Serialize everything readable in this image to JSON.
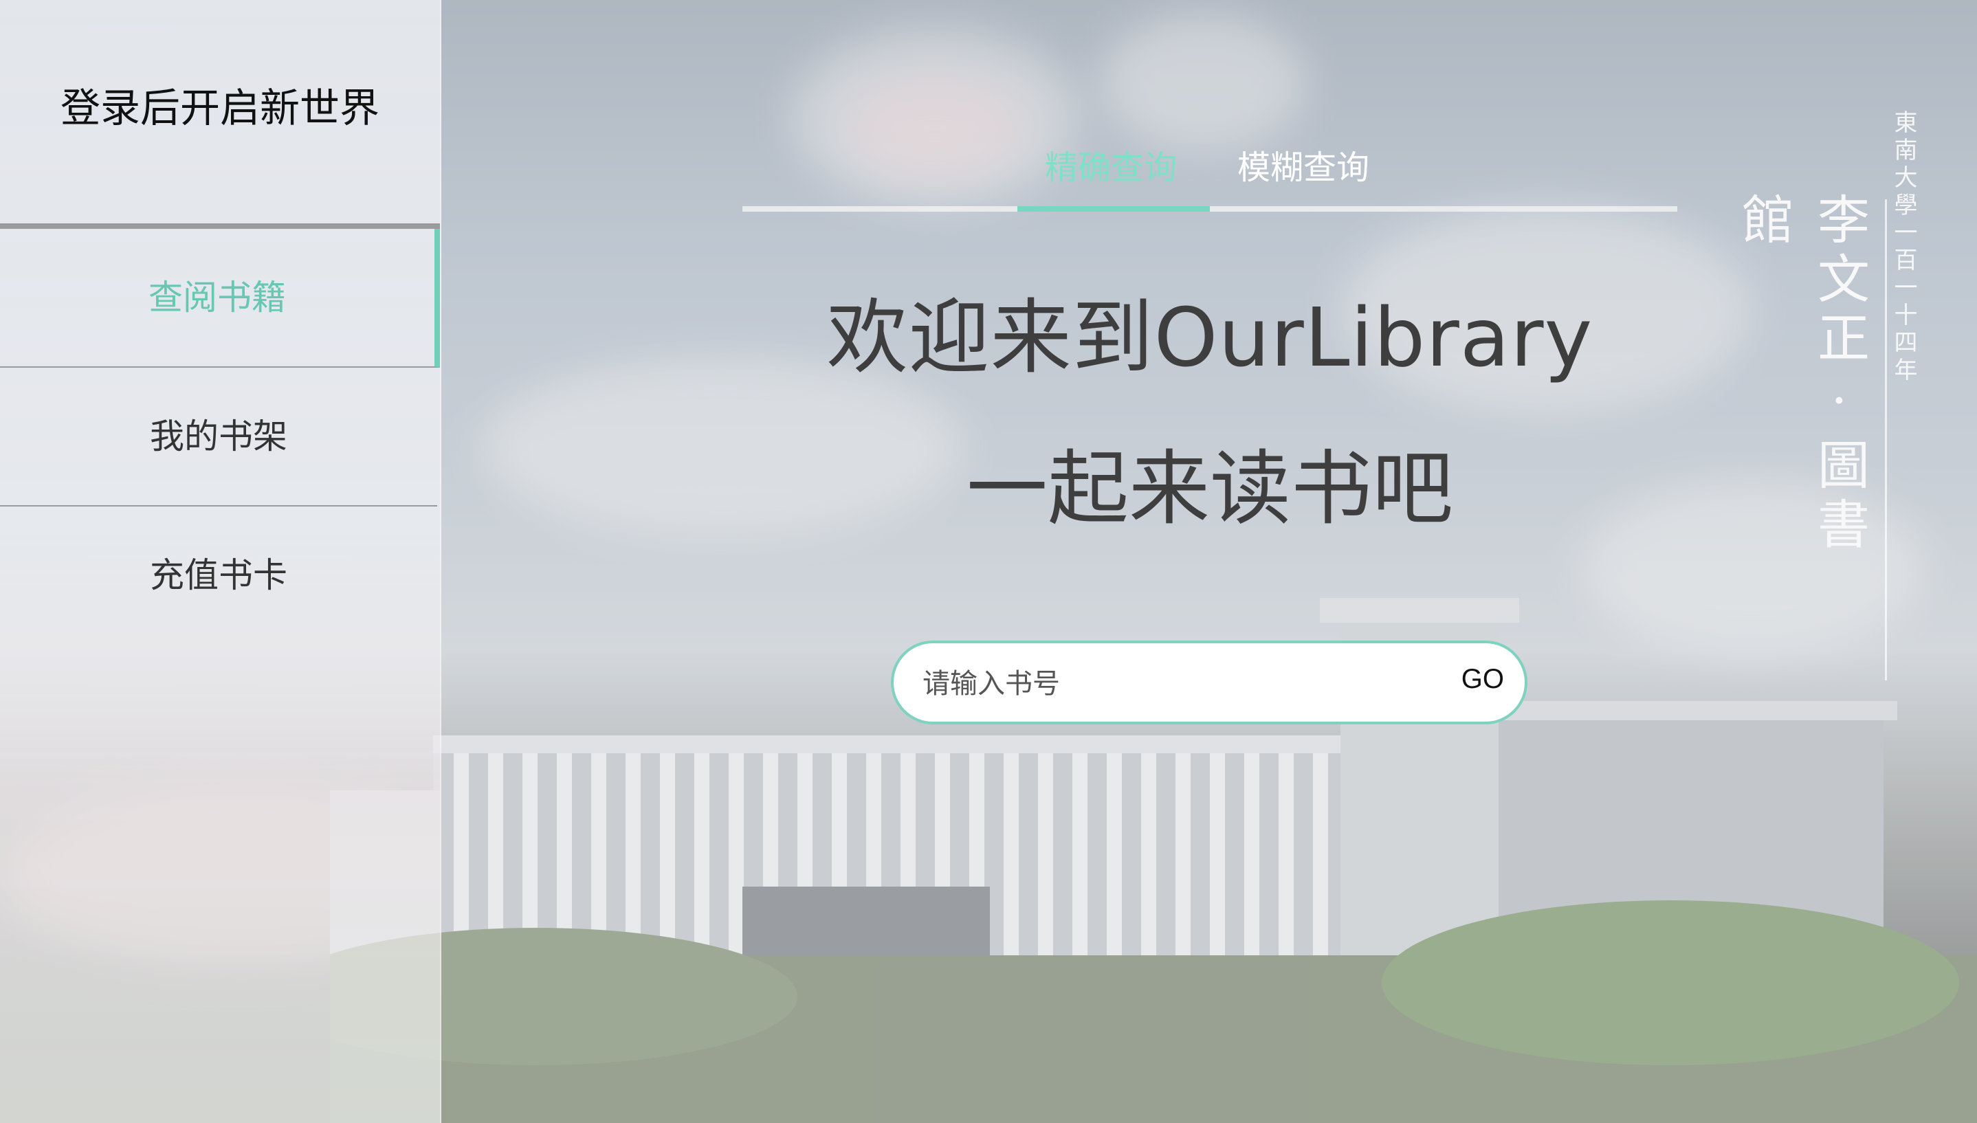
{
  "sidebar": {
    "title": "登录后开启新世界",
    "items": [
      {
        "label": "查阅书籍",
        "active": true
      },
      {
        "label": "我的书架",
        "active": false
      },
      {
        "label": "充值书卡",
        "active": false
      }
    ]
  },
  "tabs": [
    {
      "label": "精确查询",
      "active": true
    },
    {
      "label": "模糊查询",
      "active": false
    }
  ],
  "hero": {
    "welcome": "欢迎来到OurLibrary",
    "subtitle": "一起来读书吧"
  },
  "search": {
    "placeholder": "请输入书号",
    "value": "",
    "go_label": "GO"
  },
  "calligraphy": {
    "small": "東南大學一百一十四年",
    "big": "李文正·圖書館"
  },
  "colors": {
    "accent": "#6fcfb9",
    "tab_active": "#7fe0c8",
    "text_dark": "#3e3e3e"
  }
}
